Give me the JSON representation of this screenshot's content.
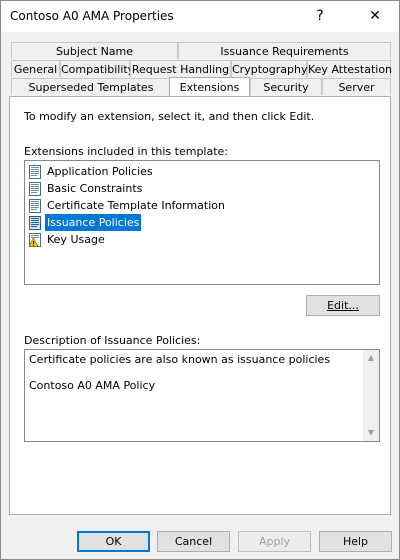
{
  "window": {
    "title": "Contoso A0 AMA Properties",
    "help_glyph": "?",
    "close_glyph": "✕"
  },
  "tabs": {
    "row1": [
      "Subject Name",
      "Issuance Requirements"
    ],
    "row2": [
      "General",
      "Compatibility",
      "Request Handling",
      "Cryptography",
      "Key Attestation"
    ],
    "row3": [
      "Superseded Templates",
      "Extensions",
      "Security",
      "Server"
    ],
    "active": "Extensions"
  },
  "extensions": {
    "instruction": "To modify an extension, select it, and then click Edit.",
    "list_label": "Extensions included in this template:",
    "items": [
      {
        "label": "Application Policies",
        "icon": "policy-extension-icon",
        "selected": false
      },
      {
        "label": "Basic Constraints",
        "icon": "policy-extension-icon",
        "selected": false
      },
      {
        "label": "Certificate Template Information",
        "icon": "policy-extension-icon",
        "selected": false
      },
      {
        "label": "Issuance Policies",
        "icon": "policy-extension-icon",
        "selected": true
      },
      {
        "label": "Key Usage",
        "icon": "warning-extension-icon",
        "selected": false
      }
    ],
    "edit_button": "Edit...",
    "description_label": "Description of Issuance Policies:",
    "description_lines": [
      "Certificate policies are also known as issuance policies",
      "Contoso A0 AMA Policy"
    ]
  },
  "footer": {
    "ok": "OK",
    "cancel": "Cancel",
    "apply": "Apply",
    "help": "Help"
  },
  "colors": {
    "selection": "#0078d7",
    "window_bg": "#f0f0f0"
  }
}
